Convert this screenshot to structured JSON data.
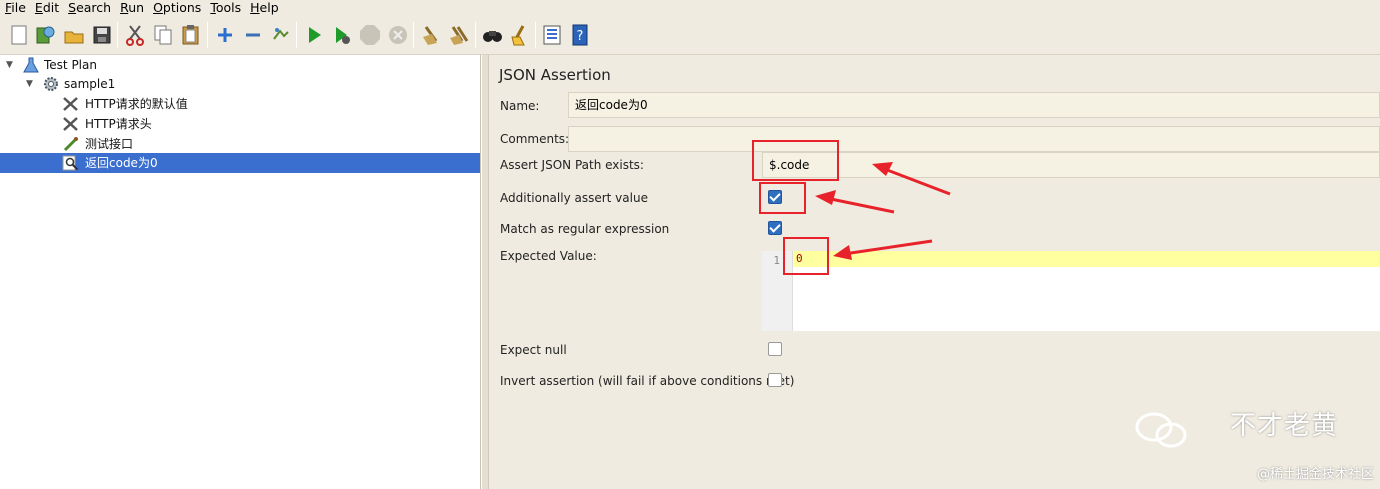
{
  "menu": {
    "file": "File",
    "file_mn": "F",
    "file_rest": "ile",
    "edit": "Edit",
    "edit_mn": "E",
    "edit_rest": "dit",
    "search": "Search",
    "search_mn": "S",
    "search_rest": "earch",
    "run": "Run",
    "run_mn": "R",
    "run_rest": "un",
    "options": "Options",
    "options_mn": "O",
    "options_rest": "ptions",
    "tools": "Tools",
    "tools_mn": "T",
    "tools_rest": "ools",
    "help": "Help",
    "help_mn": "H",
    "help_rest": "elp"
  },
  "toolbar_icons": [
    "new-icon",
    "templates-icon",
    "open-icon",
    "save-icon",
    "cut-icon",
    "copy-icon",
    "paste-icon",
    "expand-icon",
    "collapse-icon",
    "toggle-icon",
    "start-icon",
    "start-no-pause-icon",
    "stop-icon",
    "shutdown-icon",
    "clear-icon",
    "clear-all-icon",
    "search-icon",
    "reset-search-icon",
    "function-helper-icon",
    "help-icon"
  ],
  "tree": {
    "test_plan": "Test Plan",
    "sample1": "sample1",
    "http_defaults": "HTTP请求的默认值",
    "http_header": "HTTP请求头",
    "test_api": "测试接口",
    "assertion": "返回code为0"
  },
  "assertion": {
    "title": "JSON Assertion",
    "name_label": "Name:",
    "name_value": "返回code为0",
    "comments_label": "Comments:",
    "comments_value": "",
    "path_label": "Assert JSON Path exists:",
    "path_value": "$.code",
    "additionally_label": "Additionally assert value",
    "additionally_checked": true,
    "regex_label": "Match as regular expression",
    "regex_checked": true,
    "expected_label": "Expected Value:",
    "expected_line_number": "1",
    "expected_value": "0",
    "expect_null_label": "Expect null",
    "expect_null_checked": false,
    "invert_label": "Invert assertion (will fail if above conditions met)",
    "invert_checked": false
  },
  "watermark": {
    "brand": "不才老黄",
    "credit": "@稀土掘金技术社区"
  },
  "colors": {
    "selection": "#3a6fcf",
    "annotation": "#e8222a",
    "checkbox": "#2f6fbf",
    "editor_line": "#ffff9f"
  }
}
